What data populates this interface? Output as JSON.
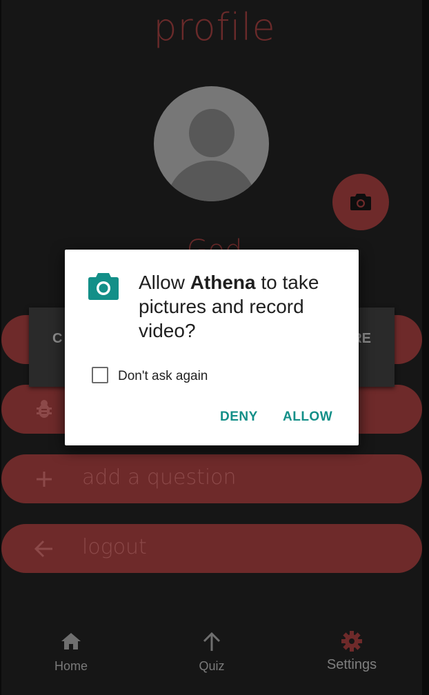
{
  "page": {
    "title": "profile",
    "username": "God"
  },
  "menu": {
    "items": [
      {
        "label": "",
        "icon": "bug-icon"
      },
      {
        "label": "add a question",
        "icon": "plus-icon"
      },
      {
        "label": "logout",
        "icon": "arrow-left-icon"
      }
    ]
  },
  "snackbar": {
    "left_text": "C",
    "right_text": "RE"
  },
  "nav": {
    "items": [
      {
        "label": "Home",
        "icon": "home-icon"
      },
      {
        "label": "Quiz",
        "icon": "arrow-up-icon"
      },
      {
        "label": "Settings",
        "icon": "gear-icon",
        "active": true
      }
    ]
  },
  "dialog": {
    "title_prefix": "Allow ",
    "app_name": "Athena",
    "title_suffix": " to take pictures and record video?",
    "checkbox_label": "Don't ask again",
    "deny_label": "DENY",
    "allow_label": "ALLOW"
  },
  "colors": {
    "background": "#161616",
    "accent_dark_red": "#6e2a2a",
    "active_nav": "#6e2a2a",
    "dialog_button": "#138f88",
    "dialog_icon": "#138f88"
  }
}
